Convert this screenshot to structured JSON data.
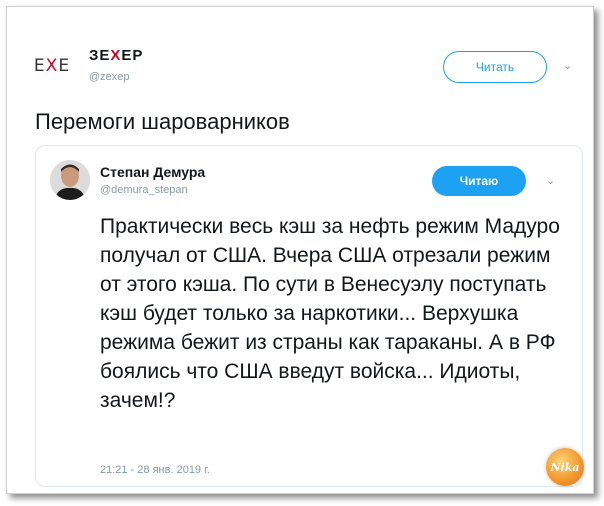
{
  "outer_tweet": {
    "avatar_logo_parts": [
      "E",
      "X",
      "E"
    ],
    "author_name_parts": [
      "ЗЕ",
      "X",
      "ЕР"
    ],
    "handle": "@zexep",
    "follow_label": "Читать",
    "text": "Перемоги шароварников"
  },
  "quoted_tweet": {
    "author_name": "Степан Демура",
    "handle": "@demura_stepan",
    "follow_label": "Читаю",
    "text": "Практически весь кэш за нефть режим Мадуро получал от США. Вчера США отрезали режим от этого кэша. По сути в Венесуэлу поступать кэш будет только за наркотики... Верхушка режима бежит из страны как тараканы. А в РФ боялись что США введут войска... Идиоты, зачем!?",
    "timestamp": "21:21 - 28 янв. 2019 г."
  },
  "watermark": {
    "text": "Nika"
  },
  "colors": {
    "accent": "#1da1f2",
    "logo_red": "#d0021b",
    "muted": "#8899a6"
  }
}
